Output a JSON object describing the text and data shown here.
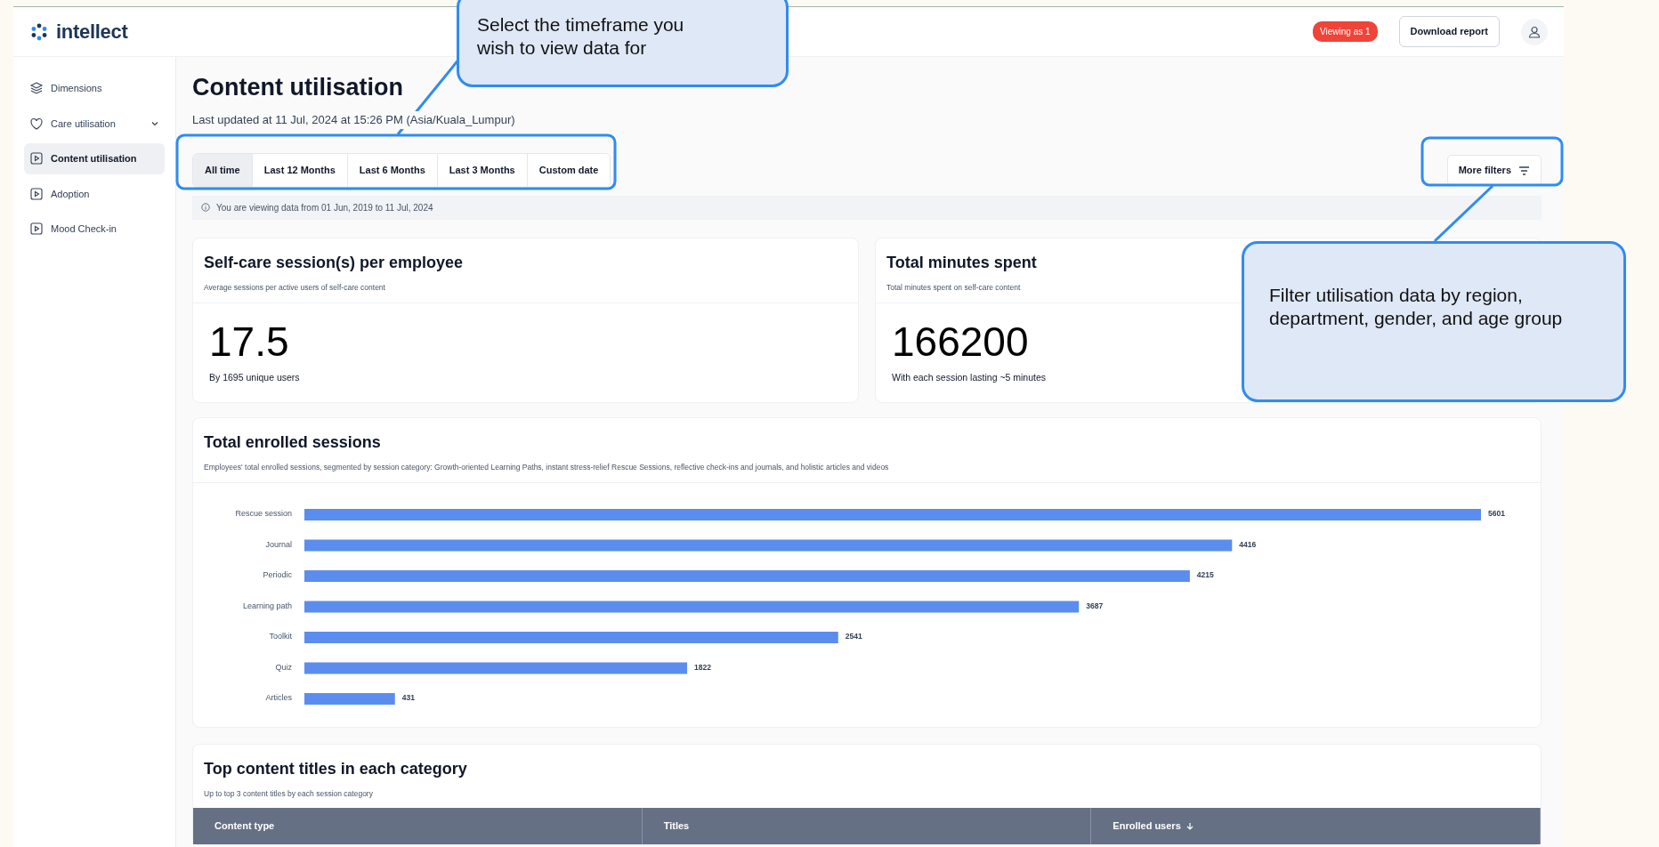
{
  "brand": {
    "name": "intellect"
  },
  "header": {
    "badge": "Viewing as 1",
    "download_button": "Download report"
  },
  "sidebar": {
    "items": [
      {
        "label": "Dimensions",
        "kind": "dimension",
        "selected": false
      },
      {
        "label": "Care utilisation",
        "kind": "group",
        "selected": false,
        "expanded": false
      },
      {
        "label": "Content utilisation",
        "kind": "page",
        "selected": true
      },
      {
        "label": "Adoption",
        "kind": "page",
        "selected": false
      },
      {
        "label": "Mood Check-in",
        "kind": "page",
        "selected": false
      }
    ]
  },
  "page": {
    "title": "Content utilisation",
    "updated": "Last updated at 11 Jul, 2024 at 15:26 PM (Asia/Kuala_Lumpur)",
    "timeframe_tabs": [
      {
        "label": "All time",
        "selected": true
      },
      {
        "label": "Last 12 Months",
        "selected": false
      },
      {
        "label": "Last 6 Months",
        "selected": false
      },
      {
        "label": "Last 3 Months",
        "selected": false
      },
      {
        "label": "Custom date",
        "selected": false
      }
    ],
    "more_filters_button": "More filters",
    "info": "You are viewing data from 01 Jun, 2019 to 11 Jul, 2024",
    "metrics": [
      {
        "title": "Self-care session(s) per employee",
        "description": "Average sessions per active users of self-care content",
        "value": "17.5",
        "note": "By 1695 unique users"
      },
      {
        "title": "Total minutes spent",
        "description": "Total minutes spent on self-care content",
        "value": "166200",
        "note": "With each session lasting ~5 minutes"
      }
    ],
    "enrolled": {
      "title": "Total enrolled sessions",
      "description": "Employees' total enrolled sessions, segmented by session category: Growth-oriented Learning Paths, instant stress-relief Rescue Sessions, reflective check-ins and journals, and holistic articles and videos",
      "chart_data": {
        "type": "bar",
        "orientation": "horizontal",
        "data_labels": true,
        "categories": [
          "Rescue session",
          "Journal",
          "Periodic",
          "Learning path",
          "Toolkit",
          "Quiz",
          "Articles"
        ],
        "values": [
          5601,
          4416,
          4215,
          3687,
          2541,
          1822,
          431
        ]
      }
    },
    "top_titles": {
      "title": "Top content titles in each category",
      "description": "Up to top 3 content titles by each session category",
      "columns": [
        {
          "label": "Content type",
          "sorted": false
        },
        {
          "label": "Titles",
          "sorted": false
        },
        {
          "label": "Enrolled users",
          "sorted": true
        }
      ]
    }
  },
  "callouts": [
    {
      "text": "Select the timeframe you wish to view data for"
    },
    {
      "text": "Filter utilisation data by region, department, gender, and age group"
    }
  ]
}
